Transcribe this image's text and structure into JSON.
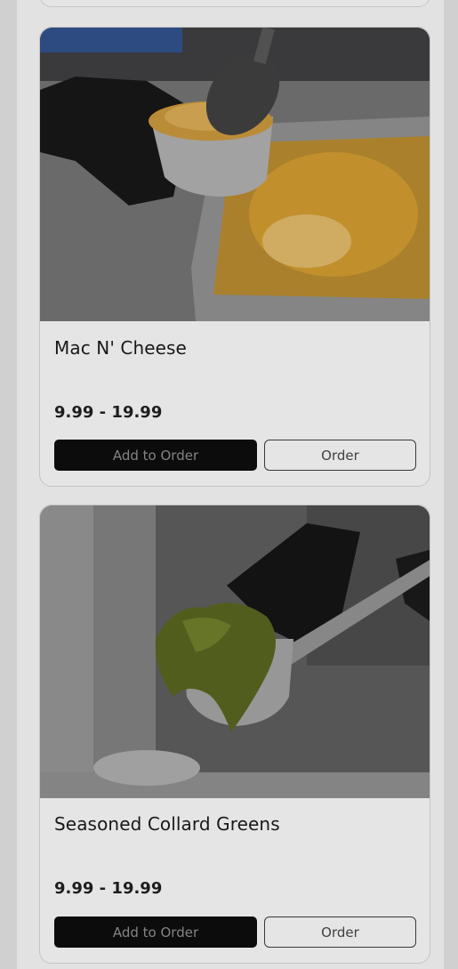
{
  "products": [
    {
      "name": "Mac N' Cheese",
      "price": "9.99 - 19.99",
      "add_label": "Add to Order",
      "order_label": "Order",
      "image": "mac-and-cheese-photo"
    },
    {
      "name": "Seasoned Collard Greens",
      "price": "9.99 - 19.99",
      "add_label": "Add to Order",
      "order_label": "Order",
      "image": "collard-greens-photo"
    }
  ],
  "colors": {
    "page_bg": "#ececec",
    "add_button_bg": "#0d0d0d",
    "order_button_border": "#3c3c3c"
  }
}
